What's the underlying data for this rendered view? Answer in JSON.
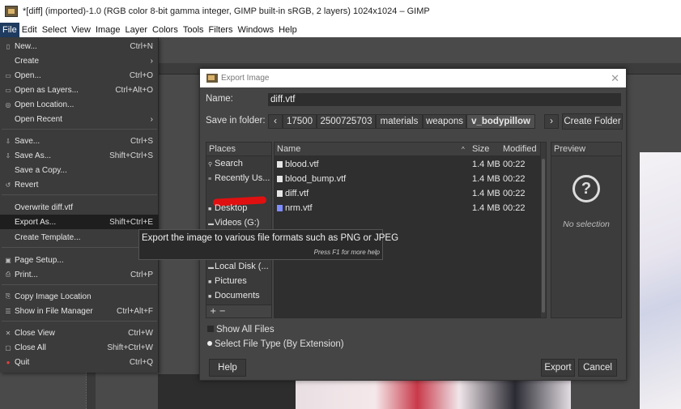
{
  "window": {
    "title": "*[diff] (imported)-1.0 (RGB color 8-bit gamma integer, GIMP built-in sRGB, 2 layers) 1024x1024 – GIMP"
  },
  "menubar": [
    "File",
    "Edit",
    "Select",
    "View",
    "Image",
    "Layer",
    "Colors",
    "Tools",
    "Filters",
    "Windows",
    "Help"
  ],
  "file_menu": {
    "new": {
      "label": "New...",
      "accel": "Ctrl+N"
    },
    "create": {
      "label": "Create",
      "accel": "›"
    },
    "open": {
      "label": "Open...",
      "accel": "Ctrl+O"
    },
    "open_layers": {
      "label": "Open as Layers...",
      "accel": "Ctrl+Alt+O"
    },
    "open_location": {
      "label": "Open Location...",
      "accel": ""
    },
    "open_recent": {
      "label": "Open Recent",
      "accel": "›"
    },
    "save": {
      "label": "Save...",
      "accel": "Ctrl+S"
    },
    "save_as": {
      "label": "Save As...",
      "accel": "Shift+Ctrl+S"
    },
    "save_copy": {
      "label": "Save a Copy...",
      "accel": ""
    },
    "revert": {
      "label": "Revert",
      "accel": ""
    },
    "overwrite": {
      "label": "Overwrite diff.vtf",
      "accel": ""
    },
    "export_as": {
      "label": "Export As...",
      "accel": "Shift+Ctrl+E"
    },
    "create_template": {
      "label": "Create Template...",
      "accel": ""
    },
    "page_setup": {
      "label": "Page Setup...",
      "accel": ""
    },
    "print": {
      "label": "Print...",
      "accel": "Ctrl+P"
    },
    "copy_location": {
      "label": "Copy Image Location",
      "accel": ""
    },
    "show_manager": {
      "label": "Show in File Manager",
      "accel": "Ctrl+Alt+F"
    },
    "close_view": {
      "label": "Close View",
      "accel": "Ctrl+W"
    },
    "close_all": {
      "label": "Close All",
      "accel": "Shift+Ctrl+W"
    },
    "quit": {
      "label": "Quit",
      "accel": "Ctrl+Q"
    }
  },
  "tooltip": {
    "text": "Export the image to various file formats such as PNG or JPEG",
    "hint": "Press F1 for more help"
  },
  "dialog": {
    "title": "Export Image",
    "name_label": "Name:",
    "name_value": "diff.vtf",
    "folder_label": "Save in folder:",
    "crumbs": [
      "‹",
      "17500",
      "2500725703",
      "materials",
      "weapons",
      "v_bodypillow",
      "›"
    ],
    "create_folder": "Create Folder",
    "places_header": "Places",
    "places": [
      "Search",
      "Recently Us...",
      "",
      "Desktop",
      "Videos (G:)",
      "Local Disk (...",
      "Pictures",
      "Documents"
    ],
    "places_footer": "+  −",
    "files_header": {
      "name": "Name",
      "size": "Size",
      "modified": "Modified"
    },
    "files": [
      {
        "name": "blood.vtf",
        "size": "1.4 MB",
        "modified": "00:22"
      },
      {
        "name": "blood_bump.vtf",
        "size": "1.4 MB",
        "modified": "00:22"
      },
      {
        "name": "diff.vtf",
        "size": "1.4 MB",
        "modified": "00:22"
      },
      {
        "name": "nrm.vtf",
        "size": "1.4 MB",
        "modified": "00:22"
      }
    ],
    "preview_header": "Preview",
    "preview_msg": "No selection",
    "show_all": "Show All Files",
    "select_type": "Select File Type (By Extension)",
    "help": "Help",
    "export": "Export",
    "cancel": "Cancel"
  }
}
